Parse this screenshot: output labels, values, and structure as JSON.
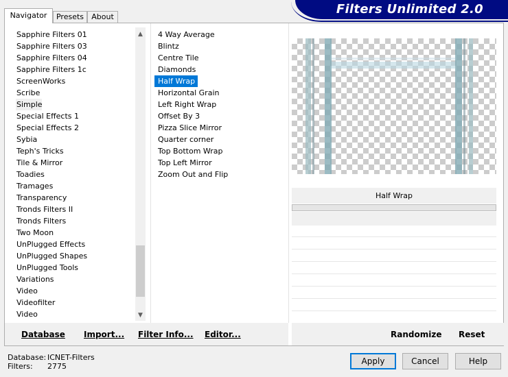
{
  "tabs": [
    {
      "label": "Navigator",
      "active": true
    },
    {
      "label": "Presets",
      "active": false
    },
    {
      "label": "About",
      "active": false
    }
  ],
  "app_title": "Filters Unlimited 2.0",
  "categories": [
    "Sapphire Filters 01",
    "Sapphire Filters 03",
    "Sapphire Filters 04",
    "Sapphire Filters 1c",
    "ScreenWorks",
    "Scribe",
    "Simple",
    "Special Effects 1",
    "Special Effects 2",
    "Sybia",
    "Teph's Tricks",
    "Tile & Mirror",
    "Toadies",
    "Tramages",
    "Transparency",
    "Tronds Filters II",
    "Tronds Filters",
    "Two Moon",
    "UnPlugged Effects",
    "UnPlugged Shapes",
    "UnPlugged Tools",
    "Variations",
    "Video",
    "Videofilter",
    "Video"
  ],
  "current_category": "Simple",
  "filters": [
    "4 Way Average",
    "Blintz",
    "Centre Tile",
    "Diamonds",
    "Half Wrap",
    "Horizontal Grain",
    "Left Right Wrap",
    "Offset By 3",
    "Pizza Slice Mirror",
    "Quarter corner",
    "Top Bottom Wrap",
    "Top Left Mirror",
    "Zoom Out and Flip"
  ],
  "selected_filter": "Half Wrap",
  "param_header": "Half Wrap",
  "actions": {
    "database": "Database",
    "import": "Import...",
    "filter_info": "Filter Info...",
    "editor": "Editor...",
    "randomize": "Randomize",
    "reset": "Reset"
  },
  "status": {
    "database_label": "Database:",
    "database_value": "ICNET-Filters",
    "filters_label": "Filters:",
    "filters_value": "2775"
  },
  "buttons": {
    "apply": "Apply",
    "cancel": "Cancel",
    "help": "Help"
  },
  "icons": {
    "scroll_up": "chevron-up-icon",
    "scroll_down": "chevron-down-icon"
  },
  "colors": {
    "title_bg": "#000b82",
    "selection": "#0078d7"
  }
}
